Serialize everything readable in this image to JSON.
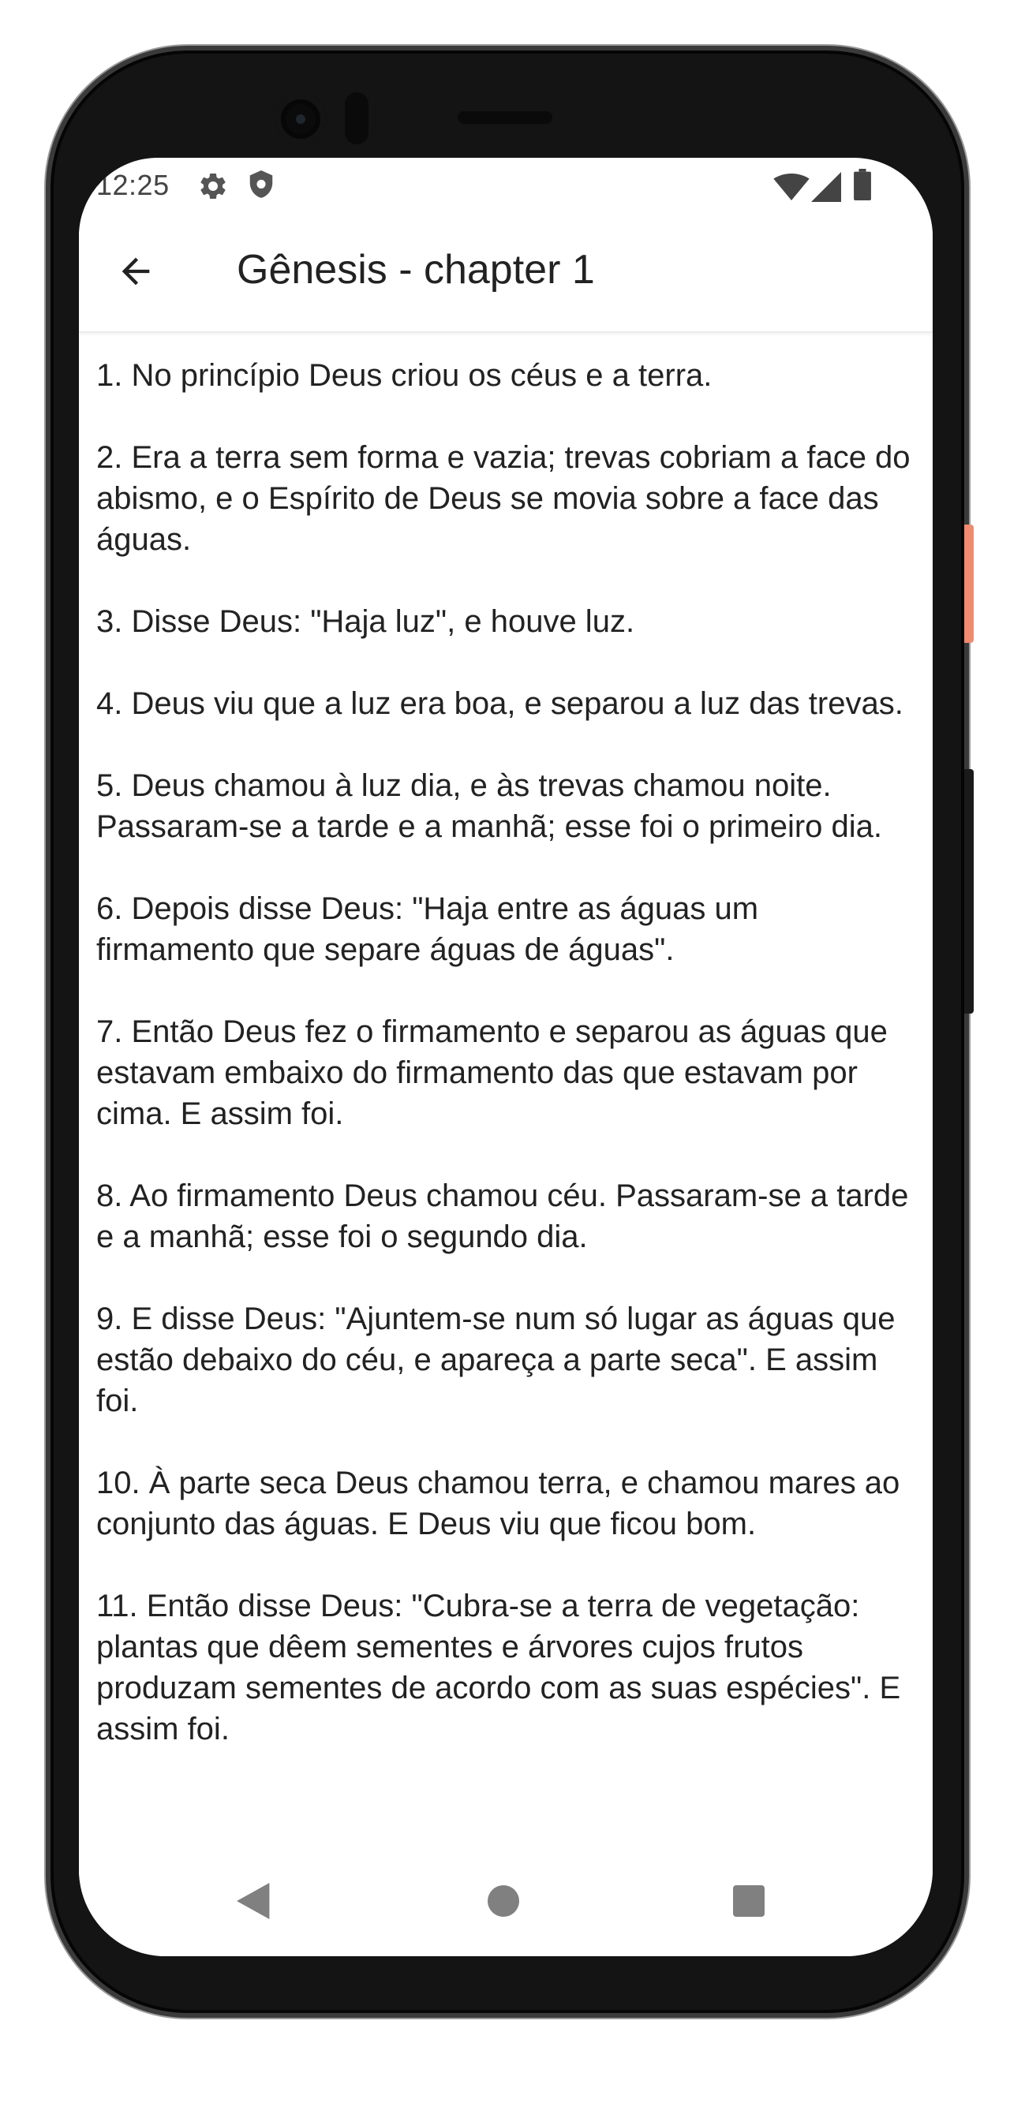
{
  "status_bar": {
    "time": "12:25",
    "icons": [
      "gear-icon",
      "shield-icon",
      "wifi-icon",
      "signal-icon",
      "battery-icon"
    ]
  },
  "app_bar": {
    "back_icon": "arrow-left-icon",
    "title": "Gênesis - chapter 1"
  },
  "verses": [
    "1. No princípio Deus criou os céus e a terra.",
    "2. Era a terra sem forma e vazia; trevas cobriam a face do abismo, e o Espírito de Deus se movia sobre a face das águas.",
    "3. Disse Deus: \"Haja luz\", e houve luz.",
    "4. Deus viu que a luz era boa, e separou a luz das trevas.",
    "5. Deus chamou à luz dia, e às trevas chamou noite. Passaram-se a tarde e a manhã; esse foi o primeiro dia.",
    "6. Depois disse Deus: \"Haja entre as águas um firmamento que separe águas de águas\".",
    "7. Então Deus fez o firmamento e separou as águas que estavam embaixo do firmamento das que estavam por cima. E assim foi.",
    "8. Ao firmamento Deus chamou céu. Passaram-se a tarde e a manhã; esse foi o segundo dia.",
    "9. E disse Deus: \"Ajuntem-se num só lugar as águas que estão debaixo do céu, e apareça a parte seca\". E assim foi.",
    "10. À parte seca Deus chamou terra, e chamou mares ao conjunto das águas. E Deus viu que ficou bom.",
    "11. Então disse Deus: \"Cubra-se a terra de vegetação: plantas que dêem sementes e árvores cujos frutos produzam sementes de acordo com as suas espécies\". E assim foi."
  ],
  "nav_bar": {
    "icons": [
      "nav-back-icon",
      "nav-home-icon",
      "nav-recents-icon"
    ]
  },
  "colors": {
    "text": "#222222",
    "nav_icons": "#808080",
    "side_button_accent": "#f08a70"
  }
}
